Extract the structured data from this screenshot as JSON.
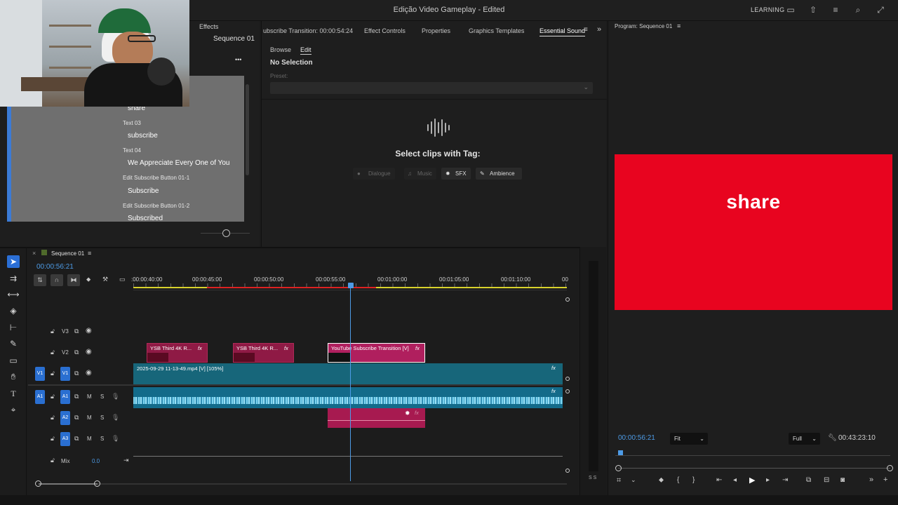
{
  "window": {
    "title": "Edição Video Gameplay - Edited",
    "learning_label": "LEARNING"
  },
  "left_panel": {
    "tab_effects": "Effects",
    "sequence_label": "Sequence 01",
    "more_label": "•••",
    "graphics_items": [
      {
        "sub": "",
        "main": "share"
      },
      {
        "sub": "Text 03",
        "main": "subscribe"
      },
      {
        "sub": "Text 04",
        "main": "We Appreciate Every One of You"
      },
      {
        "sub": "Edit Subscribe Button 01-1",
        "main": "Subscribe"
      },
      {
        "sub": "Edit Subscribe Button 01-2",
        "main": "Subscribed"
      }
    ]
  },
  "essential_sound": {
    "tabs": [
      "ubscribe Transition: 00:00:54:24",
      "Effect Controls",
      "Properties",
      "Graphics Templates",
      "Essential Sound"
    ],
    "subtabs": [
      "Browse",
      "Edit"
    ],
    "no_selection": "No Selection",
    "preset_label": "Preset:",
    "select_clips_label": "Select clips with Tag:",
    "tags": [
      "Dialogue",
      "Music",
      "SFX",
      "Ambience"
    ]
  },
  "program_monitor": {
    "title": "Program: Sequence 01",
    "video_text": "share",
    "timecode": "00:00:56:21",
    "fit_option": "Fit",
    "quality_option": "Full",
    "duration": "00:43:23:10",
    "video_color": "#e8041f"
  },
  "timeline": {
    "sequence_name": "Sequence 01",
    "timecode": "00:00:56:21",
    "ruler_labels": [
      ":00:00:40:00",
      "00:00:45:00",
      "00:00:50:00",
      "00:00:55:00",
      "00:01:00:00",
      "00:01:05:00",
      "00:01:10:00",
      "00"
    ],
    "tracks": {
      "v3": "V3",
      "v2": "V2",
      "v1_src": "V1",
      "v1": "V1",
      "a1_src": "A1",
      "a1": "A1",
      "a2": "A2",
      "a3": "A3",
      "mix_label": "Mix",
      "mix_value": "0.0",
      "mute": "M",
      "solo": "S"
    },
    "clips": {
      "v2_a": "YSB Third 4K R...",
      "v2_b": "YSB Third 4K R...",
      "v2_c": "YouTube Subscribe Transition [V]",
      "v1": "2025-09-29 11-13-49.mp4 [V] [105%]",
      "fx": "fx"
    },
    "meter_label": "S S"
  }
}
